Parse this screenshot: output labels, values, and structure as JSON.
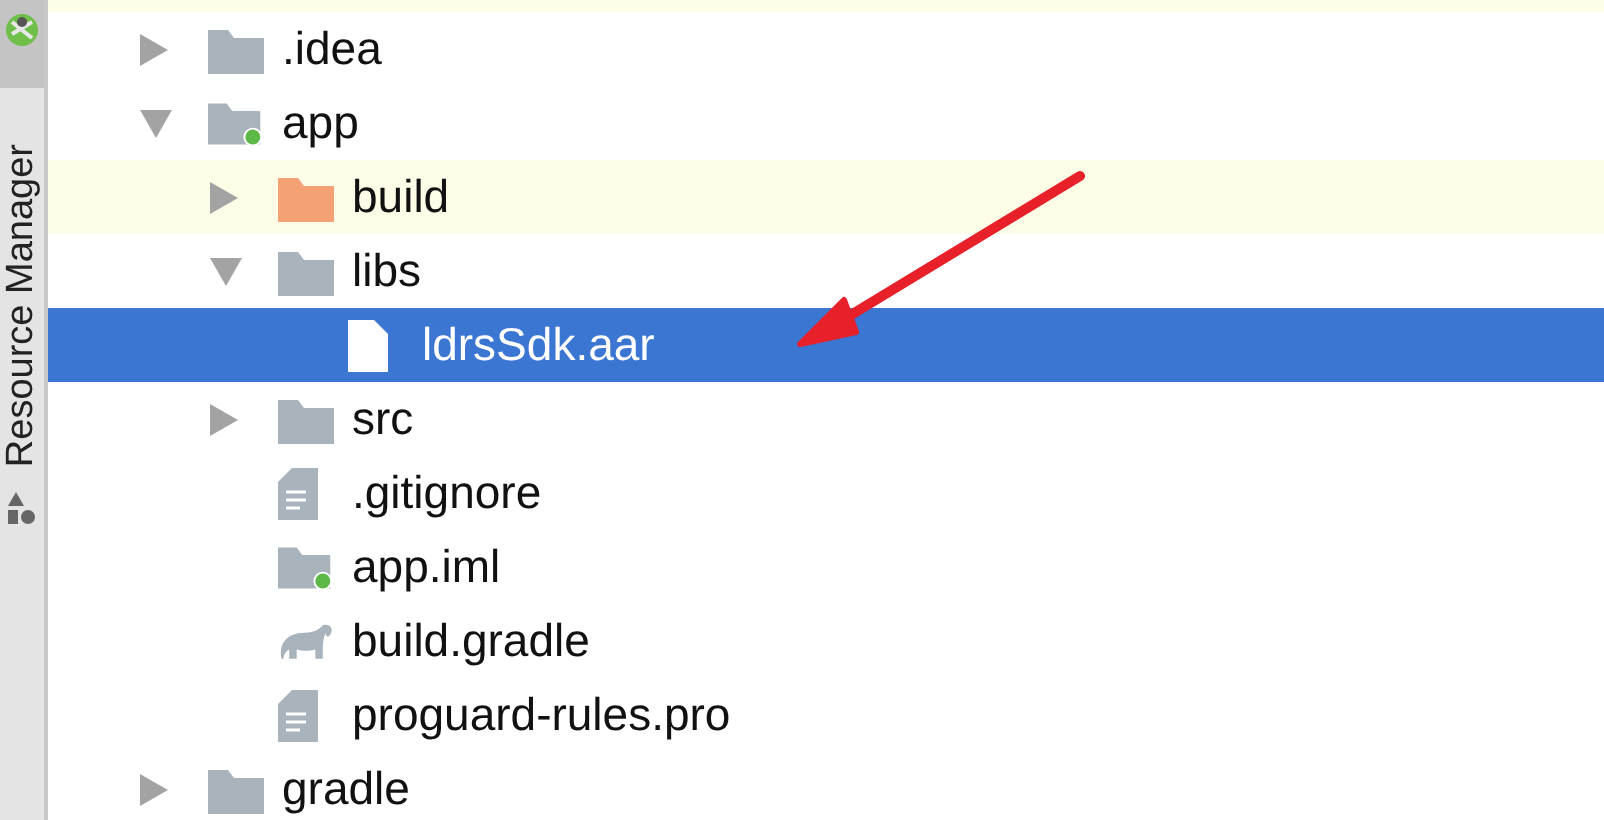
{
  "sidebar": {
    "tabs": [
      {
        "label": "Resource Manager",
        "selected": false
      }
    ]
  },
  "tree": [
    {
      "label": ".idea",
      "kind": "folder",
      "expanded": false,
      "selected": false,
      "highlighted": false
    },
    {
      "label": "app",
      "kind": "module",
      "expanded": true,
      "selected": false,
      "highlighted": false,
      "children": [
        {
          "label": "build",
          "kind": "excluded",
          "expanded": false,
          "selected": false,
          "highlighted": true
        },
        {
          "label": "libs",
          "kind": "folder",
          "expanded": true,
          "selected": false,
          "highlighted": false,
          "children": [
            {
              "label": "ldrsSdk.aar",
              "kind": "file",
              "selected": true,
              "highlighted": false
            }
          ]
        },
        {
          "label": "src",
          "kind": "folder",
          "expanded": false,
          "selected": false,
          "highlighted": false
        },
        {
          "label": ".gitignore",
          "kind": "text",
          "selected": false,
          "highlighted": false
        },
        {
          "label": "app.iml",
          "kind": "iml",
          "selected": false,
          "highlighted": false
        },
        {
          "label": "build.gradle",
          "kind": "gradle",
          "selected": false,
          "highlighted": false
        },
        {
          "label": "proguard-rules.pro",
          "kind": "text",
          "selected": false,
          "highlighted": false
        }
      ]
    },
    {
      "label": "gradle",
      "kind": "folder",
      "expanded": false,
      "selected": false,
      "highlighted": false
    }
  ]
}
